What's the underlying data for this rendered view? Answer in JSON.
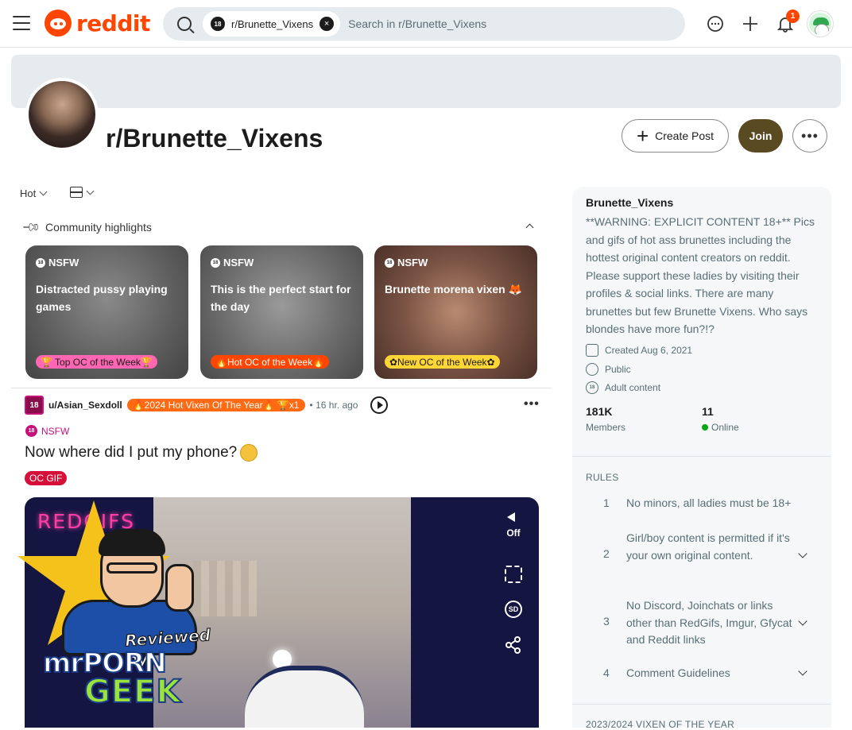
{
  "header": {
    "logo_text": "reddit",
    "search_chip": "r/Brunette_Vixens",
    "search_placeholder": "Search in r/Brunette_Vixens",
    "notification_count": "1",
    "brand_color": "#ff4500"
  },
  "community": {
    "title": "r/Brunette_Vixens",
    "create_post_label": "Create Post",
    "join_label": "Join"
  },
  "feed": {
    "sort_label": "Hot",
    "highlights_label": "Community highlights",
    "highlights": [
      {
        "nsfw": "NSFW",
        "title": "Distracted pussy playing games",
        "flair": "🏆 Top OC of the Week🏆"
      },
      {
        "nsfw": "NSFW",
        "title": "This is the perfect start for the day",
        "flair": "🔥Hot OC of the Week🔥"
      },
      {
        "nsfw": "NSFW",
        "title": "Brunette morena vixen 🦊",
        "flair": "✿New OC of the Week✿"
      }
    ]
  },
  "post": {
    "author": "u/Asian_Sexdoll",
    "author_flair": "🔥2024 Hot Vixen Of The Year🔥 🏆x1",
    "time": "• 16 hr. ago",
    "nsfw": "NSFW",
    "title": "Now where did I put my phone?",
    "flair": "OC GIF",
    "media_brand": "REDGIFS",
    "mute_label": "Off",
    "sd_label": "SD"
  },
  "watermark": {
    "reviewed_by": "Reviewed by",
    "brand_top": "mrPORN",
    "brand_bottom": "GEEK"
  },
  "sidebar": {
    "name": "Brunette_Vixens",
    "description": "**WARNING: EXPLICIT CONTENT 18+** Pics and gifs of hot ass brunettes including the hottest original content creators on reddit. Please support these ladies by visiting their profiles & social links. There are many brunettes but few Brunette Vixens. Who says blondes have more fun?!?",
    "created": "Created Aug 6, 2021",
    "visibility": "Public",
    "content_rating": "Adult content",
    "members_count": "181K",
    "members_label": "Members",
    "online_count": "11",
    "online_label": "Online",
    "rules_header": "RULES",
    "rules": [
      {
        "num": "1",
        "text": "No minors, all ladies must be 18+"
      },
      {
        "num": "2",
        "text": "Girl/boy content is permitted if it's your own original content."
      },
      {
        "num": "3",
        "text": "No Discord, Joinchats or links other than RedGifs, Imgur, Gfycat and Reddit links"
      },
      {
        "num": "4",
        "text": "Comment Guidelines"
      }
    ],
    "footer_header": "2023/2024 VIXEN OF THE YEAR"
  }
}
